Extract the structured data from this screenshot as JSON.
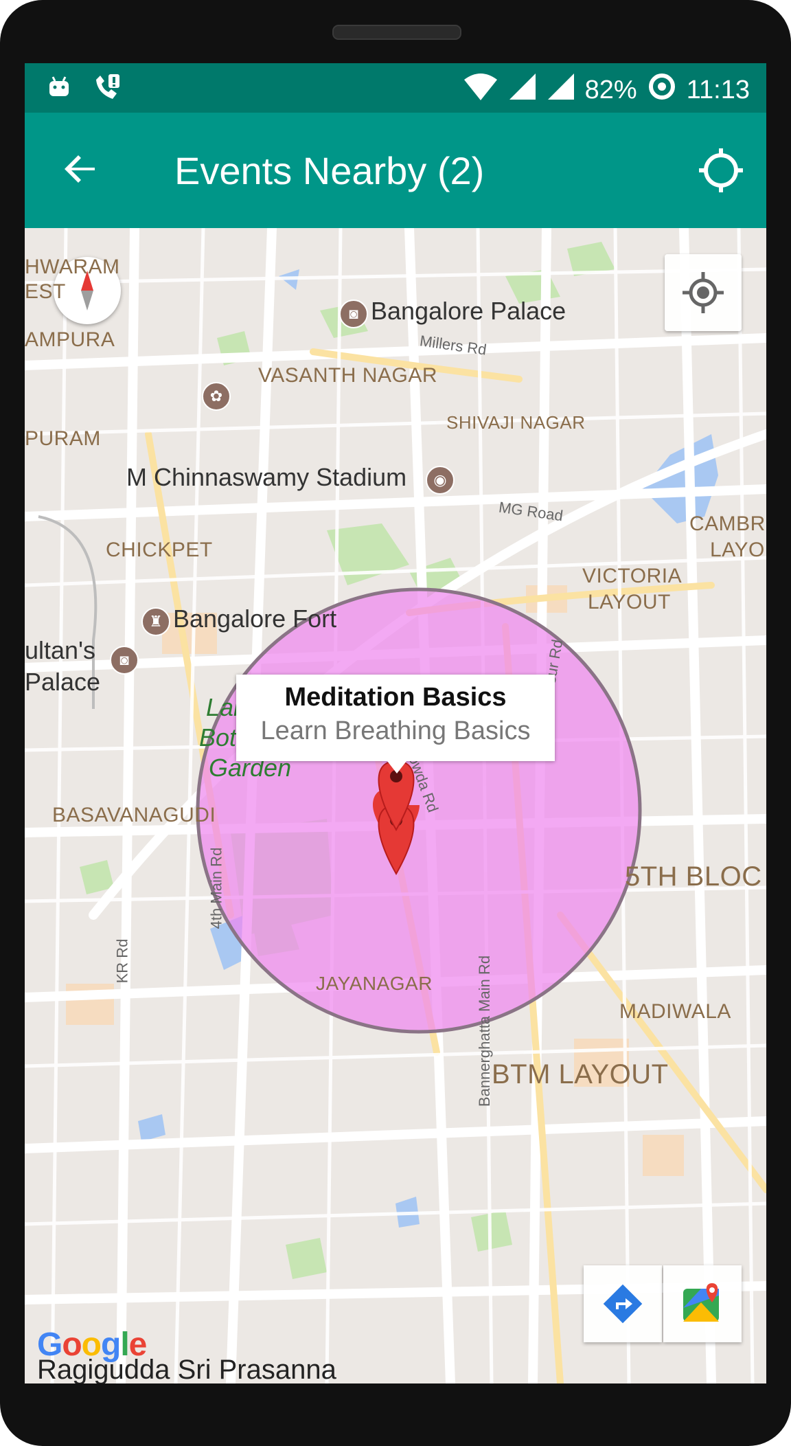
{
  "status_bar": {
    "battery": "82%",
    "time": "11:13",
    "icons": [
      "android-icon",
      "phone-alert-icon",
      "wifi-icon",
      "signal-icon",
      "signal-icon",
      "battery-ring-icon"
    ]
  },
  "app_bar": {
    "title": "Events Nearby (2)",
    "back_icon": "arrow-back-icon",
    "action_icon": "gps-fixed-icon",
    "color": "#009688",
    "status_color": "#00796b"
  },
  "map": {
    "places": {
      "bangalore_palace": "Bangalore Palace",
      "vasanth_nagar": "VASANTH NAGAR",
      "shivaji_nagar": "SHIVAJI NAGAR",
      "chinnaswamy": "M Chinnaswamy Stadium",
      "chickpet": "CHICKPET",
      "bangalore_fort": "Bangalore Fort",
      "tipu_palace_1": "ultan's",
      "tipu_palace_2": "Palace",
      "lalbagh": "Lalbagh\nBotanical\nGarden",
      "basavanagudi": "BASAVANAGUDI",
      "jayanagar": "JAYANAGAR",
      "fifth_block": "5TH BLOC",
      "madiwala": "MADIWALA",
      "btm_layout": "BTM LAYOUT",
      "victoria_layout_1": "VICTORIA",
      "victoria_layout_2": "LAYOUT",
      "cambridge_1": "CAMBR",
      "cambridge_2": "LAYO",
      "ampura": "AMPURA",
      "puram": "PURAM",
      "hwaram_1": "HWARAM",
      "hwaram_2": "EST",
      "bottom": "Ragigudda Sri Prasanna"
    },
    "roads": {
      "millers": "Millers Rd",
      "mg": "MG Road",
      "hosur": "Hosur Rd",
      "marigowda": "Marigowda Rd",
      "fourth_main": "4th Main Rd",
      "kr": "KR Rd",
      "bannerghatta": "Bannerghatta Main Rd"
    },
    "info_window": {
      "title": "Meditation Basics",
      "snippet": "Learn Breathing Basics"
    },
    "radius_fill": "#ee88ee",
    "marker_color": "#e53935",
    "google_logo": "Google"
  }
}
